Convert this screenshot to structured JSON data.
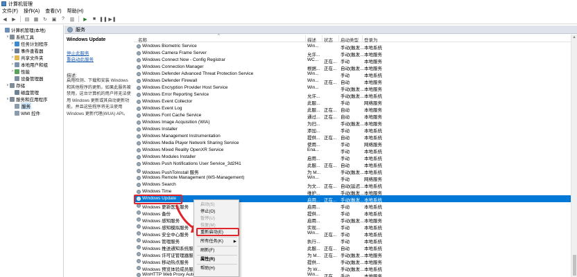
{
  "window": {
    "title": "计算机管理"
  },
  "menu": [
    "文件(F)",
    "操作(A)",
    "查看(V)",
    "帮助(H)"
  ],
  "toolbar": [
    {
      "name": "back-icon",
      "glyph": "◀"
    },
    {
      "name": "forward-icon",
      "glyph": "▶"
    },
    {
      "name": "up-folder-icon",
      "glyph": "▤"
    },
    {
      "name": "show-hide-tree-icon",
      "glyph": "▦"
    },
    {
      "name": "refresh-icon",
      "glyph": "↻"
    },
    {
      "name": "export-icon",
      "glyph": "▣"
    },
    {
      "name": "help-icon",
      "glyph": "?"
    },
    {
      "name": "properties-icon",
      "glyph": "▥"
    },
    {
      "name": "play-icon",
      "glyph": "▶"
    },
    {
      "name": "stop-icon",
      "glyph": "■"
    },
    {
      "name": "pause-icon",
      "glyph": "❚❚"
    },
    {
      "name": "restart-icon",
      "glyph": "▶❚"
    }
  ],
  "tree": [
    {
      "label": "计算机管理(本地)",
      "level": 0,
      "expander": "",
      "color": "#6b8fb8"
    },
    {
      "label": "系统工具",
      "level": 1,
      "expander": "∨",
      "color": "#7f8c99"
    },
    {
      "label": "任务计划程序",
      "level": 2,
      "expander": ">",
      "color": "#3c8bd0"
    },
    {
      "label": "事件查看器",
      "level": 2,
      "expander": ">",
      "color": "#6a7f95"
    },
    {
      "label": "共享文件夹",
      "level": 2,
      "expander": ">",
      "color": "#e0b84f"
    },
    {
      "label": "本地用户和组",
      "level": 2,
      "expander": ">",
      "color": "#7b93ad"
    },
    {
      "label": "性能",
      "level": 2,
      "expander": ">",
      "color": "#59a35a"
    },
    {
      "label": "设备管理器",
      "level": 2,
      "expander": "",
      "color": "#7d8ea0"
    },
    {
      "label": "存储",
      "level": 1,
      "expander": "∨",
      "color": "#7f8c99"
    },
    {
      "label": "磁盘管理",
      "level": 2,
      "expander": "",
      "color": "#6f8197"
    },
    {
      "label": "服务和应用程序",
      "level": 1,
      "expander": "∨",
      "color": "#7f8c99"
    },
    {
      "label": "服务",
      "level": 2,
      "expander": "",
      "color": "#8a9bab",
      "selected": true
    },
    {
      "label": "WMI 控件",
      "level": 2,
      "expander": "",
      "color": "#8a9bab"
    }
  ],
  "panel": {
    "title": "服务"
  },
  "description": {
    "service_title": "Windows Update",
    "link_stop": "停止此服务",
    "link_restart": "重启动此服务",
    "label": "描述:",
    "text": "启用检测、下载和安装 Windows 和其他程序的更新。如果此服务被禁用，这台计算机的用户将无法使用 Windows 更新或其自动更新功能，并且这些程序将无法使用 Windows 更新代理(WUA) API。"
  },
  "columns": {
    "name": "名称",
    "desc": "描述",
    "status": "状态",
    "startup": "启动类型",
    "logon": "登录为"
  },
  "services": [
    {
      "name": "Windows Biometric Service",
      "desc": "Win...",
      "status": "",
      "startup": "手动(触发...",
      "logon": "本地系统"
    },
    {
      "name": "Windows Camera Frame Server",
      "desc": "允许...",
      "status": "",
      "startup": "手动(触发...",
      "logon": "本地服务"
    },
    {
      "name": "Windows Connect Now - Config Registrar",
      "desc": "WC...",
      "status": "正在...",
      "startup": "手动",
      "logon": "本地服务"
    },
    {
      "name": "Windows Connection Manager",
      "desc": "根据...",
      "status": "正在...",
      "startup": "自动(触发...",
      "logon": "本地服务"
    },
    {
      "name": "Windows Defender Advanced Threat Protection Service",
      "desc": "Win...",
      "status": "",
      "startup": "手动",
      "logon": "本地系统"
    },
    {
      "name": "Windows Defender Firewall",
      "desc": "Win...",
      "status": "正在...",
      "startup": "自动",
      "logon": "本地服务"
    },
    {
      "name": "Windows Encryption Provider Host Service",
      "desc": "Win...",
      "status": "",
      "startup": "手动(触发...",
      "logon": "本地服务"
    },
    {
      "name": "Windows Error Reporting Service",
      "desc": "允许...",
      "status": "",
      "startup": "手动(触发...",
      "logon": "本地系统"
    },
    {
      "name": "Windows Event Collector",
      "desc": "此服...",
      "status": "",
      "startup": "手动",
      "logon": "网络服务"
    },
    {
      "name": "Windows Event Log",
      "desc": "此服...",
      "status": "正在...",
      "startup": "自动",
      "logon": "本地服务"
    },
    {
      "name": "Windows Font Cache Service",
      "desc": "通过...",
      "status": "正在...",
      "startup": "自动",
      "logon": "本地服务"
    },
    {
      "name": "Windows Image Acquisition (WIA)",
      "desc": "为扫...",
      "status": "",
      "startup": "手动(触发...",
      "logon": "本地服务"
    },
    {
      "name": "Windows Installer",
      "desc": "添加...",
      "status": "",
      "startup": "手动",
      "logon": "本地系统"
    },
    {
      "name": "Windows Management Instrumentation",
      "desc": "提供...",
      "status": "正在...",
      "startup": "自动",
      "logon": "本地系统"
    },
    {
      "name": "Windows Media Player Network Sharing Service",
      "desc": "使用...",
      "status": "",
      "startup": "手动",
      "logon": "网络服务"
    },
    {
      "name": "Windows Mixed Reality OpenXR Service",
      "desc": "Ena...",
      "status": "",
      "startup": "手动",
      "logon": "本地系统"
    },
    {
      "name": "Windows Modules Installer",
      "desc": "启用...",
      "status": "",
      "startup": "手动",
      "logon": "本地系统"
    },
    {
      "name": "Windows Push Notifications User Service_3d2f41",
      "desc": "此服...",
      "status": "正在...",
      "startup": "自动",
      "logon": "本地系统"
    },
    {
      "name": "Windows PushToInstall 服务",
      "desc": "为 M...",
      "status": "",
      "startup": "手动(触发...",
      "logon": "本地系统"
    },
    {
      "name": "Windows Remote Management (WS-Management)",
      "desc": "Win...",
      "status": "",
      "startup": "手动",
      "logon": "网络服务"
    },
    {
      "name": "Windows Search",
      "desc": "为文...",
      "status": "正在...",
      "startup": "自动(延迟...",
      "logon": "本地系统"
    },
    {
      "name": "Windows Time",
      "desc": "维护...",
      "status": "",
      "startup": "手动(触发...",
      "logon": "本地服务"
    },
    {
      "name": "Windows Update",
      "desc": "启用...",
      "status": "正在...",
      "startup": "手动(触发...",
      "logon": "本地系统",
      "selected": true
    },
    {
      "name": "Windows 更新医生服务",
      "desc": "启用...",
      "status": "",
      "startup": "手动",
      "logon": "本地系统"
    },
    {
      "name": "Windows 备份",
      "desc": "提供...",
      "status": "",
      "startup": "手动",
      "logon": "本地系统"
    },
    {
      "name": "Windows 感知服务",
      "desc": "启用...",
      "status": "",
      "startup": "手动(触发...",
      "logon": "本地服务"
    },
    {
      "name": "Windows 感知模拟服务",
      "desc": "实现...",
      "status": "",
      "startup": "手动",
      "logon": "本地系统"
    },
    {
      "name": "Windows 安全中心服务",
      "desc": "Win...",
      "status": "正在...",
      "startup": "手动",
      "logon": "本地系统"
    },
    {
      "name": "Windows 管理服务",
      "desc": "执行...",
      "status": "",
      "startup": "手动",
      "logon": "本地系统"
    },
    {
      "name": "Windows 推送通知系统服务",
      "desc": "此服...",
      "status": "正在...",
      "startup": "自动",
      "logon": "本地系统"
    },
    {
      "name": "Windows 许可证管理器服务",
      "desc": "为 M...",
      "status": "正在...",
      "startup": "手动(触发...",
      "logon": "本地服务"
    },
    {
      "name": "Windows 移动热点服务",
      "desc": "提供...",
      "status": "",
      "startup": "手动(触发...",
      "logon": "本地服务"
    },
    {
      "name": "Windows 预览体验成员服务",
      "desc": "为 W...",
      "status": "",
      "startup": "手动(触发...",
      "logon": "本地系统"
    },
    {
      "name": "WinHTTP Web Proxy Auto...",
      "desc": "Win...",
      "status": "正在...",
      "startup": "手动",
      "logon": "本地服务"
    }
  ],
  "context_menu": [
    {
      "label": "启动(S)",
      "disabled": true
    },
    {
      "label": "停止(O)",
      "disabled": false
    },
    {
      "label": "暂停(U)",
      "disabled": true
    },
    {
      "label": "恢复(M)",
      "disabled": true
    },
    {
      "label": "重新启动(E)",
      "disabled": false,
      "highlight": true
    },
    {
      "sep": true
    },
    {
      "label": "所有任务(K)",
      "disabled": false,
      "submenu": true
    },
    {
      "sep": true
    },
    {
      "label": "刷新(F)",
      "disabled": false
    },
    {
      "sep": true
    },
    {
      "label": "属性(R)",
      "disabled": false,
      "bold": true
    },
    {
      "sep": true
    },
    {
      "label": "帮助(H)",
      "disabled": false
    }
  ],
  "colors": {
    "selection": "#0078d7",
    "annotation": "#e0242a",
    "link": "#1a5cb0"
  }
}
